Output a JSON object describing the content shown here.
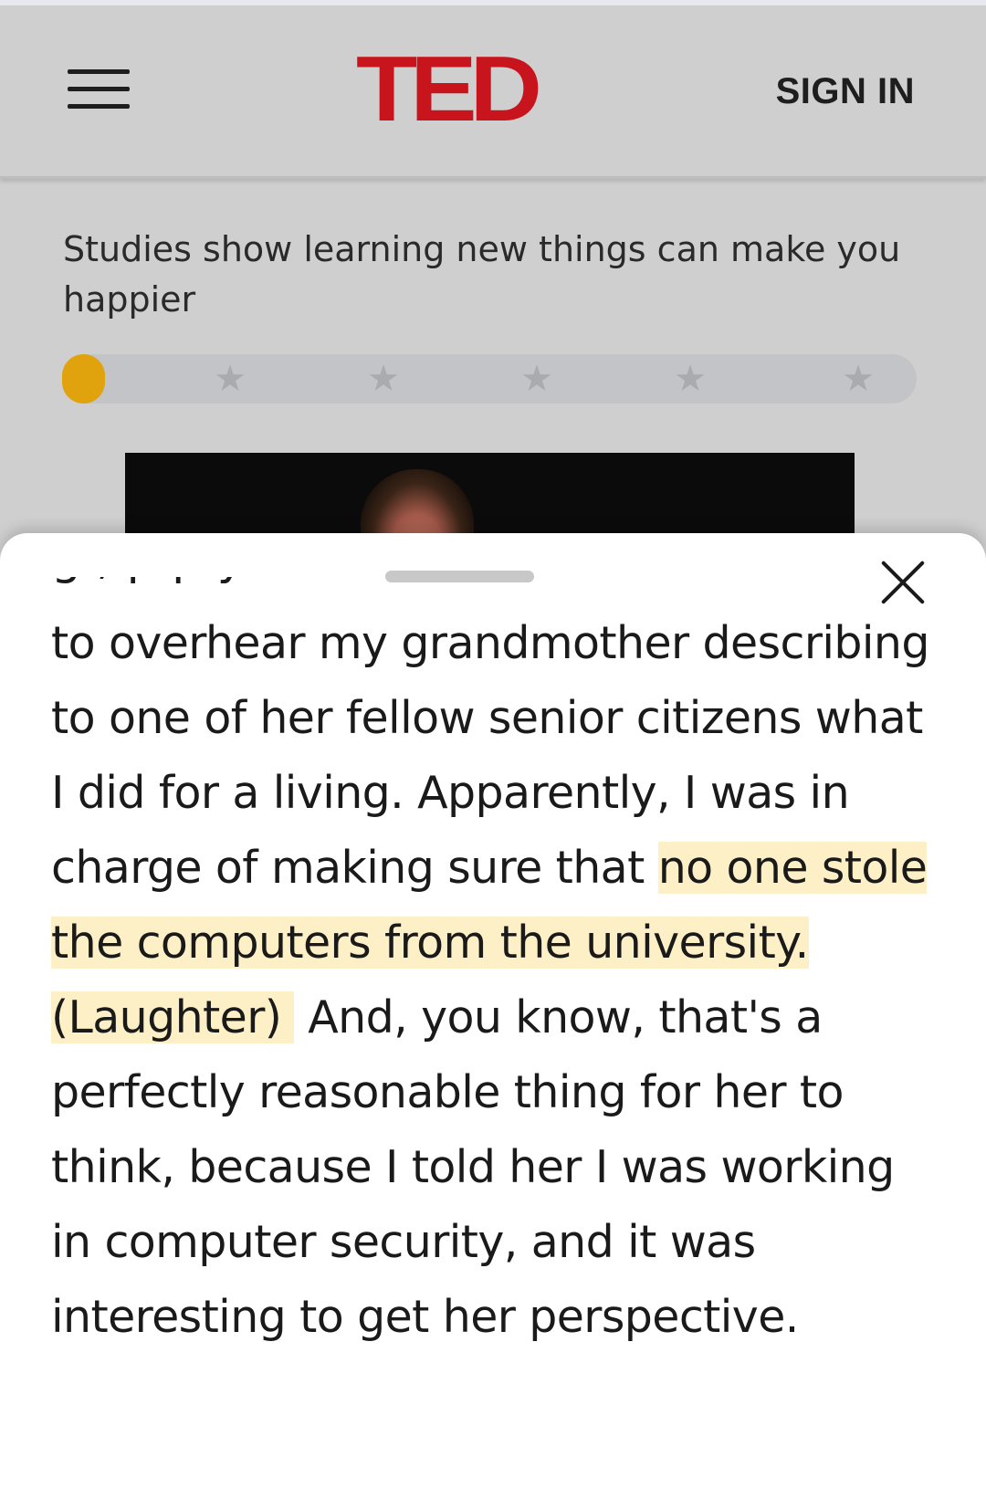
{
  "header": {
    "logo_text": "TED",
    "signin_label": "SIGN IN"
  },
  "promo": {
    "text": "Studies show learning new things can make you happier",
    "progress_fraction": 0.05,
    "star_count": 5,
    "colors": {
      "fill": "#e0a30e",
      "track": "#c2c4c7"
    }
  },
  "transcript": {
    "cut_line": "g                    ,                 p  p              y",
    "before": "to overhear my grandmother describing to one of her fellow senior citizens what I did for a living. Apparently, I was in charge of making sure that ",
    "highlight": "no one stole the computers from the university.",
    "laughter": "(Laughter)",
    "after": " And, you know, that's a perfectly reasonable thing for her to think, because I told her I was working in computer security, and it was interesting to get her perspective.",
    "highlight_color": "#fdefc6"
  },
  "brand_color": "#c8141d"
}
